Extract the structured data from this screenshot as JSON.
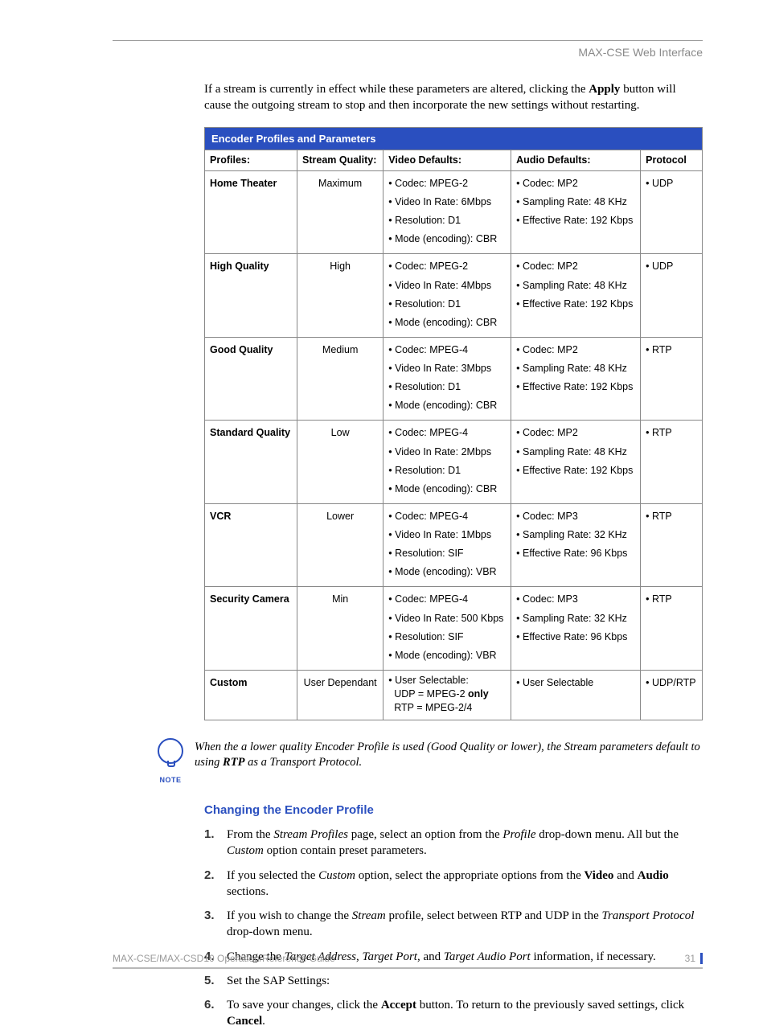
{
  "header": {
    "title": "MAX-CSE Web Interface"
  },
  "intro": {
    "pre": "If a stream is currently in effect while these parameters are altered, clicking the ",
    "bold": "Apply",
    "post": " button will cause the outgoing stream to stop and then incorporate the new settings without restarting."
  },
  "table": {
    "title": "Encoder Profiles and Parameters",
    "cols": {
      "c1": "Profiles:",
      "c2": "Stream Quality:",
      "c3": "Video Defaults:",
      "c4": "Audio Defaults:",
      "c5": "Protocol"
    },
    "rows": [
      {
        "profile": "Home Theater",
        "quality": "Maximum",
        "video": [
          "Codec: MPEG-2",
          "Video In Rate: 6Mbps",
          "Resolution: D1",
          "Mode (encoding): CBR"
        ],
        "audio": [
          "Codec: MP2",
          "Sampling Rate: 48 KHz",
          "Effective Rate: 192 Kbps"
        ],
        "protocol": "UDP"
      },
      {
        "profile": "High Quality",
        "quality": "High",
        "video": [
          "Codec: MPEG-2",
          "Video In Rate: 4Mbps",
          "Resolution: D1",
          "Mode (encoding): CBR"
        ],
        "audio": [
          "Codec: MP2",
          "Sampling Rate: 48 KHz",
          "Effective Rate: 192 Kbps"
        ],
        "protocol": "UDP"
      },
      {
        "profile": "Good Quality",
        "quality": "Medium",
        "video": [
          "Codec: MPEG-4",
          "Video In Rate: 3Mbps",
          "Resolution: D1",
          "Mode (encoding): CBR"
        ],
        "audio": [
          "Codec: MP2",
          "Sampling Rate: 48 KHz",
          "Effective Rate: 192 Kbps"
        ],
        "protocol": "RTP"
      },
      {
        "profile": "Standard Quality",
        "quality": "Low",
        "video": [
          "Codec: MPEG-4",
          "Video In Rate: 2Mbps",
          "Resolution: D1",
          "Mode (encoding): CBR"
        ],
        "audio": [
          "Codec: MP2",
          "Sampling Rate: 48 KHz",
          "Effective Rate: 192 Kbps"
        ],
        "protocol": "RTP"
      },
      {
        "profile": "VCR",
        "quality": "Lower",
        "video": [
          "Codec: MPEG-4",
          "Video In Rate: 1Mbps",
          "Resolution: SIF",
          "Mode (encoding): VBR"
        ],
        "audio": [
          "Codec: MP3",
          "Sampling Rate: 32 KHz",
          "Effective Rate: 96 Kbps"
        ],
        "protocol": "RTP"
      },
      {
        "profile": "Security Camera",
        "quality": "Min",
        "video": [
          "Codec: MPEG-4",
          "Video In Rate: 500 Kbps",
          "Resolution: SIF",
          "Mode (encoding): VBR"
        ],
        "audio": [
          "Codec: MP3",
          "Sampling Rate: 32 KHz",
          "Effective Rate: 96 Kbps"
        ],
        "protocol": "RTP"
      },
      {
        "profile": "Custom",
        "quality": "User Dependant",
        "video_custom": {
          "l1": "• User Selectable:",
          "l2a": "UDP = MPEG-2 ",
          "l2b": "only",
          "l3": "RTP = MPEG-2/4"
        },
        "audio": [
          "User Selectable"
        ],
        "protocol": "UDP/RTP"
      }
    ]
  },
  "note": {
    "label": "NOTE",
    "t1": "When the a lower quality Encoder Profile is used (Good Quality or lower), the Stream parameters default to using ",
    "b": "RTP",
    "t2": " as a Transport Protocol."
  },
  "section_heading": "Changing the Encoder Profile",
  "steps": {
    "s1": {
      "a": "From the ",
      "i1": "Stream Profiles",
      "b": " page, select an option from the ",
      "i2": "Profile",
      "c": " drop-down menu. All but the ",
      "i3": "Custom",
      "d": " option contain preset parameters."
    },
    "s2": {
      "a": "If you selected the ",
      "i1": "Custom",
      "b": " option, select the appropriate options from the ",
      "b1": "Video",
      "c": " and ",
      "b2": "Audio",
      "d": " sections."
    },
    "s3": {
      "a": "If you wish to change the ",
      "i1": "Stream",
      "b": " profile, select between RTP and UDP in the ",
      "i2": "Transport Protocol",
      "c": " drop-down menu."
    },
    "s4": {
      "a": "Change the ",
      "i1": "Target Address",
      "b": ", ",
      "i2": "Target Port",
      "c": ", and ",
      "i3": "Target Audio Port",
      "d": " information, if necessary."
    },
    "s5": {
      "a": "Set the SAP Settings:"
    },
    "s6": {
      "a": "To save your changes, click the ",
      "b1": "Accept",
      "b": " button. To return to the previously saved settings, click ",
      "b2": "Cancel",
      "c": "."
    }
  },
  "footer": {
    "left": "MAX-CSE/MAX-CSD10 Operation/Reference Guide",
    "page": "31"
  }
}
